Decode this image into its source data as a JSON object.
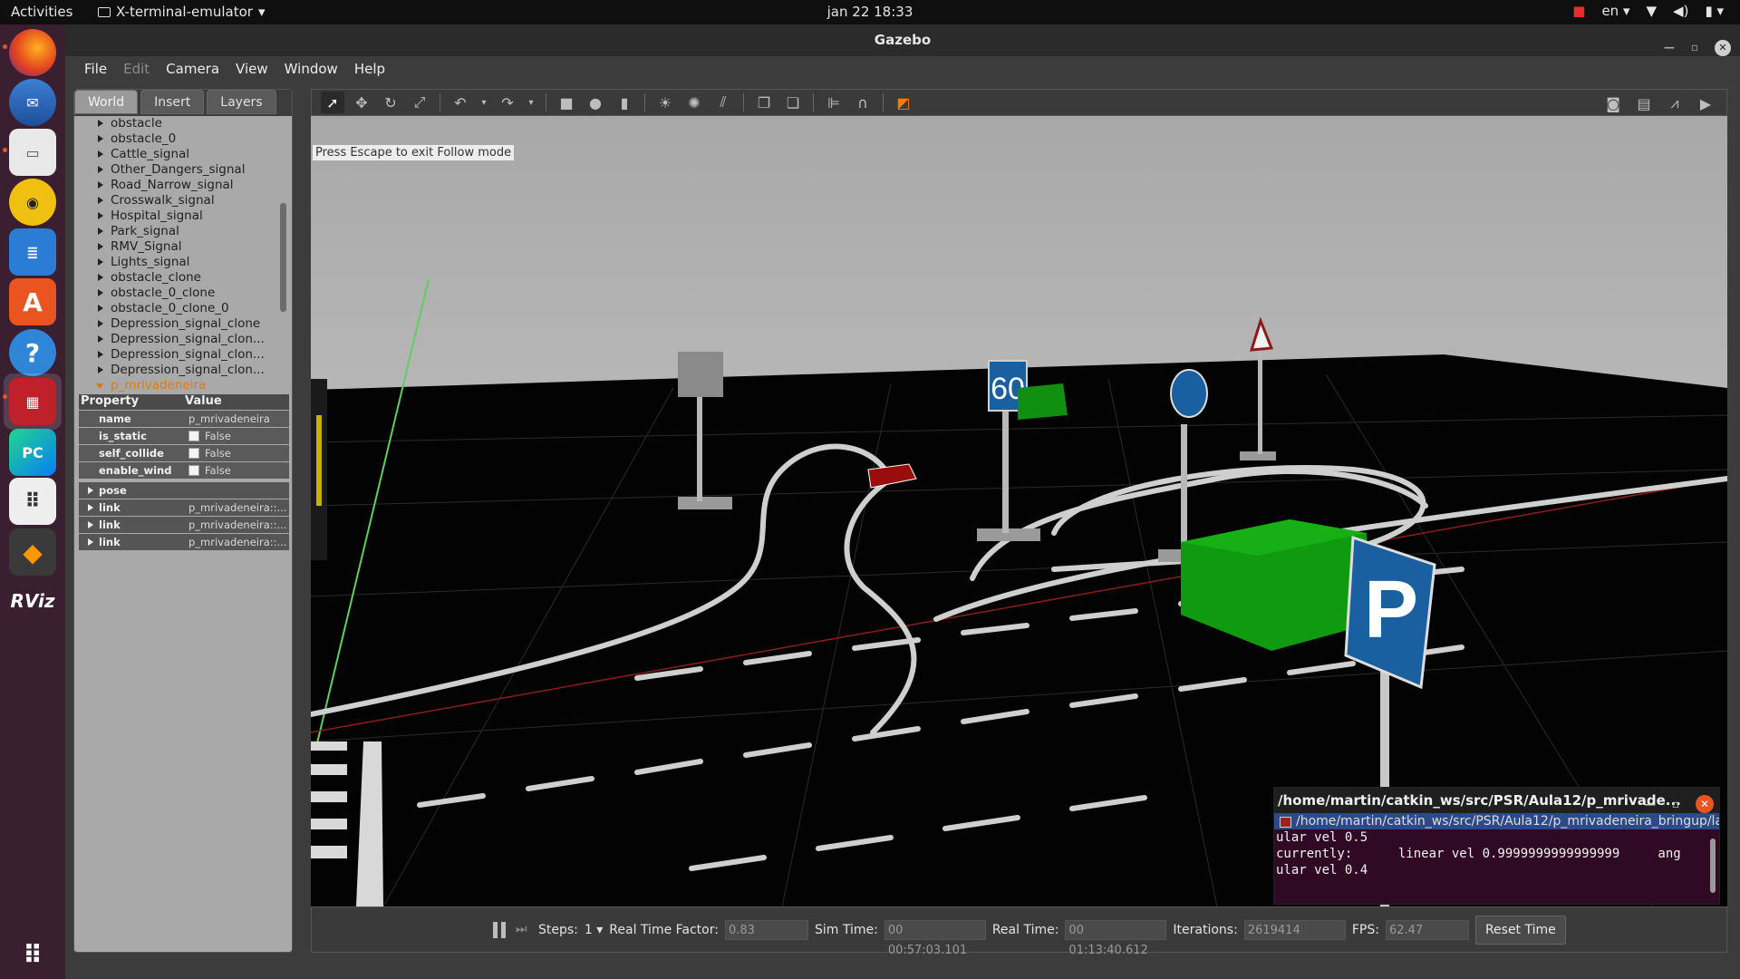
{
  "topbar": {
    "activities": "Activities",
    "app_name": "X-terminal-emulator",
    "clock": "jan 22  18:33",
    "language": "en"
  },
  "dock": {
    "items": [
      "Firefox",
      "Thunderbird",
      "Files",
      "Rhythmbox",
      "LibreOffice Writer",
      "Ubuntu Software",
      "Help",
      "Terminal",
      "PyCharm",
      "Show Applications",
      "Sublime Text",
      "RViz"
    ]
  },
  "gazebo": {
    "title": "Gazebo",
    "menu": [
      "File",
      "Edit",
      "Camera",
      "View",
      "Window",
      "Help"
    ],
    "tabs": [
      "World",
      "Insert",
      "Layers"
    ],
    "tree": [
      "obstacle",
      "obstacle_0",
      "Cattle_signal",
      "Other_Dangers_signal",
      "Road_Narrow_signal",
      "Crosswalk_signal",
      "Hospital_signal",
      "Park_signal",
      "RMV_Signal",
      "Lights_signal",
      "obstacle_clone",
      "obstacle_0_clone",
      "obstacle_0_clone_0",
      "Depression_signal_clone",
      "Depression_signal_clon...",
      "Depression_signal_clon...",
      "Depression_signal_clon..."
    ],
    "tree_selected": "p_mrivadeneira",
    "properties": {
      "header_property": "Property",
      "header_value": "Value",
      "name_key": "name",
      "name_value": "p_mrivadeneira",
      "is_static_key": "is_static",
      "is_static_value": "False",
      "self_collide_key": "self_collide",
      "self_collide_value": "False",
      "enable_wind_key": "enable_wind",
      "enable_wind_value": "False",
      "pose_key": "pose",
      "link_key": "link",
      "link_value": "p_mrivadeneira::..."
    },
    "follow_msg": "Press Escape to exit Follow mode",
    "bottom": {
      "steps_label": "Steps:",
      "steps_value": "1",
      "rtf_label": "Real Time Factor:",
      "rtf_value": "0.83",
      "sim_label": "Sim Time:",
      "sim_value": "00 00:57:03.101",
      "real_label": "Real Time:",
      "real_value": "00 01:13:40.612",
      "iter_label": "Iterations:",
      "iter_value": "2619414",
      "fps_label": "FPS:",
      "fps_value": "62.47",
      "reset_label": "Reset Time"
    },
    "scene": {
      "sign_speed": "60",
      "sign_parking": "P"
    }
  },
  "terminal": {
    "title": "/home/martin/catkin_ws/src/PSR/Aula12/p_mrivade...",
    "tab": "/home/martin/catkin_ws/src/PSR/Aula12/p_mrivadeneira_bringup/la",
    "lines": [
      "ular vel 0.5",
      "currently:      linear vel 0.9999999999999999     ang",
      "ular vel 0.4"
    ]
  }
}
